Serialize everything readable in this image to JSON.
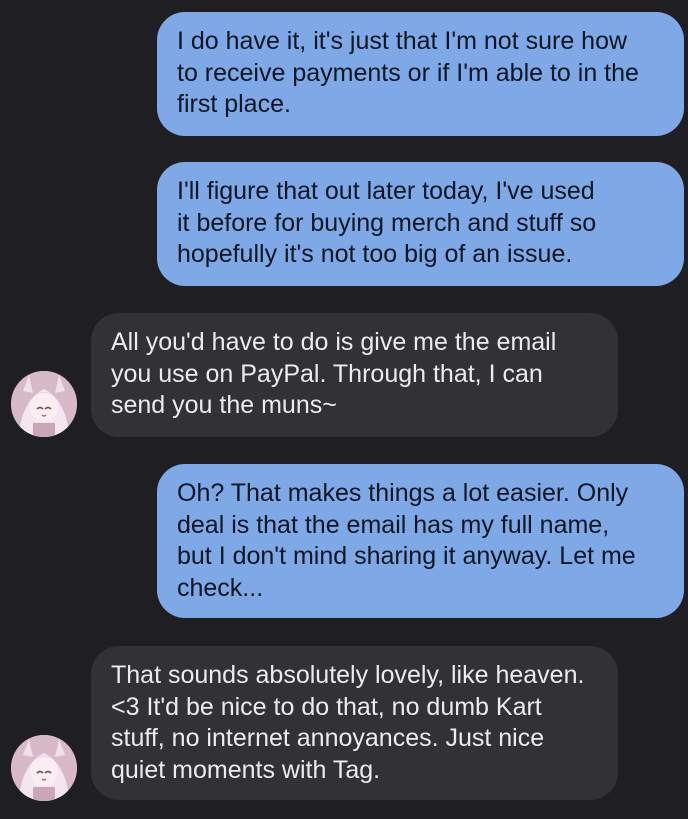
{
  "conversation": {
    "messages": [
      {
        "direction": "outgoing",
        "text": "I do have it, it's just that I'm not sure how\nto receive payments or if I'm able to in the\nfirst place."
      },
      {
        "direction": "outgoing",
        "text": "I'll figure that out later today, I've used\nit before for buying merch and stuff so\nhopefully it's not too big of an issue."
      },
      {
        "direction": "incoming",
        "text": "All you'd have to do is give me the email\nyou use on PayPal. Through that, I can\nsend you the muns~"
      },
      {
        "direction": "outgoing",
        "text": "Oh? That makes things a lot easier. Only\ndeal is that the email has my full name,\nbut I don't mind sharing it anyway. Let me\ncheck..."
      },
      {
        "direction": "incoming",
        "text": "That sounds absolutely lovely, like heaven.\n<3 It'd be nice to do that, no dumb Kart\nstuff, no internet annoyances. Just nice\nquiet moments with Tag."
      }
    ]
  },
  "colors": {
    "background": "#1f1f23",
    "outgoing_bubble": "#7fa8e6",
    "incoming_bubble": "#323236"
  }
}
